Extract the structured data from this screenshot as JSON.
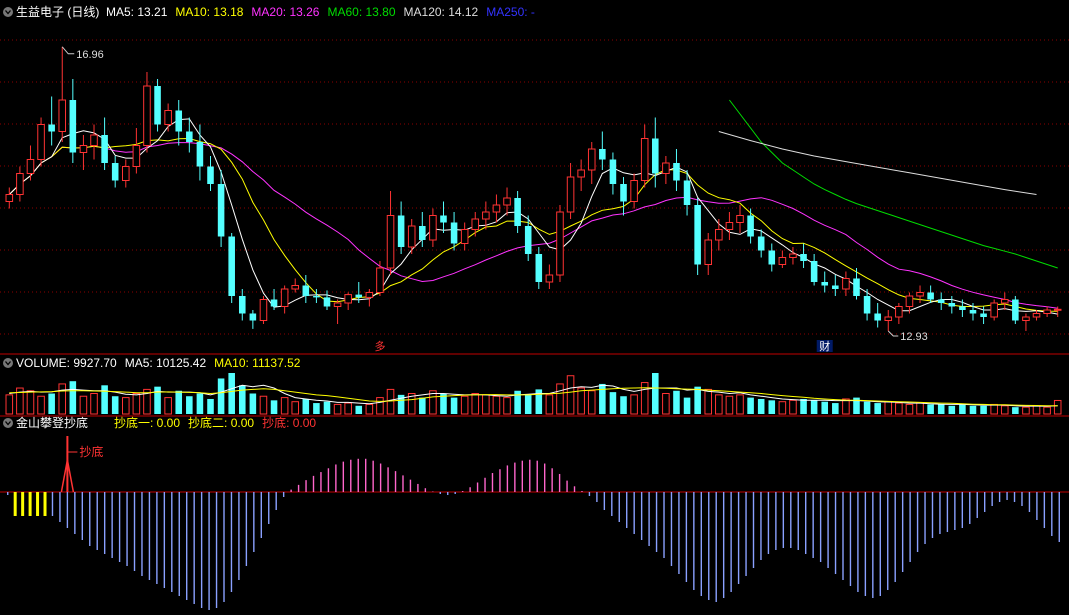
{
  "main_panel": {
    "title": "生益电子 (日线)",
    "ma_labels": [
      {
        "text": "MA5: 13.21",
        "color": "#ffffff"
      },
      {
        "text": "MA10: 13.18",
        "color": "#ffff00"
      },
      {
        "text": "MA20: 13.26",
        "color": "#ff33ff"
      },
      {
        "text": "MA60: 13.80",
        "color": "#00dd00"
      },
      {
        "text": "MA120: 14.12",
        "color": "#dddddd"
      },
      {
        "text": "MA250: -",
        "color": "#3333ff"
      }
    ],
    "high_label": "16.96",
    "low_label": "12.93",
    "event_mark_1": "多",
    "event_mark_2": "财"
  },
  "volume_panel": {
    "labels": [
      {
        "text": "VOLUME: 9927.70",
        "color": "#ffffff"
      },
      {
        "text": "MA5: 10125.42",
        "color": "#ffffff"
      },
      {
        "text": "MA10: 11137.52",
        "color": "#ffff00"
      }
    ]
  },
  "indicator_panel": {
    "title": "金山攀登抄底",
    "labels": [
      {
        "text": "抄底一: 0.00",
        "color": "#ffff00"
      },
      {
        "text": "抄底二: 0.00",
        "color": "#ffff00"
      },
      {
        "text": "抄底: 0.00",
        "color": "#ff3333"
      }
    ],
    "signal_label": "抄底"
  },
  "colors": {
    "up": "#ff3333",
    "down": "#54ffff",
    "grid": "#8b0000",
    "divider": "#c00000",
    "ma5": "#ffffff",
    "ma10": "#ffff00",
    "ma20": "#ff33ff",
    "ma60": "#00dd00",
    "ma120": "#dddddd",
    "osc_pos": "#ff66cc",
    "osc_neg": "#8aa0ff",
    "osc_signal": "#ffff00"
  },
  "chart_data": {
    "type": "candlestick",
    "y_range": [
      12.6,
      17.4
    ],
    "ohlc": [
      [
        14.75,
        14.95,
        14.65,
        14.85
      ],
      [
        14.85,
        15.25,
        14.75,
        15.15
      ],
      [
        15.15,
        15.55,
        15.05,
        15.35
      ],
      [
        15.35,
        15.95,
        15.25,
        15.85
      ],
      [
        15.85,
        16.25,
        15.55,
        15.75
      ],
      [
        15.75,
        16.96,
        15.6,
        16.2
      ],
      [
        16.2,
        16.5,
        15.3,
        15.45
      ],
      [
        15.45,
        15.7,
        15.2,
        15.55
      ],
      [
        15.55,
        15.85,
        15.35,
        15.7
      ],
      [
        15.7,
        15.95,
        15.2,
        15.3
      ],
      [
        15.3,
        15.4,
        14.95,
        15.05
      ],
      [
        15.05,
        15.35,
        14.95,
        15.25
      ],
      [
        15.25,
        15.8,
        15.15,
        15.55
      ],
      [
        15.55,
        16.6,
        15.45,
        16.4
      ],
      [
        16.4,
        16.5,
        15.75,
        15.85
      ],
      [
        15.85,
        16.15,
        15.75,
        16.05
      ],
      [
        16.05,
        16.2,
        15.55,
        15.75
      ],
      [
        15.75,
        15.95,
        15.45,
        15.6
      ],
      [
        15.6,
        15.85,
        15.05,
        15.25
      ],
      [
        15.25,
        15.4,
        14.9,
        15.0
      ],
      [
        15.0,
        15.2,
        14.1,
        14.25
      ],
      [
        14.25,
        14.3,
        13.3,
        13.4
      ],
      [
        13.4,
        13.5,
        13.05,
        13.15
      ],
      [
        13.15,
        13.2,
        12.93,
        13.05
      ],
      [
        13.05,
        13.4,
        13.0,
        13.35
      ],
      [
        13.35,
        13.5,
        13.2,
        13.25
      ],
      [
        13.25,
        13.55,
        13.15,
        13.5
      ],
      [
        13.5,
        13.65,
        13.45,
        13.55
      ],
      [
        13.55,
        13.7,
        13.3,
        13.4
      ],
      [
        13.4,
        13.5,
        13.3,
        13.38
      ],
      [
        13.38,
        13.48,
        13.2,
        13.25
      ],
      [
        13.25,
        13.35,
        13.0,
        13.3
      ],
      [
        13.3,
        13.45,
        13.2,
        13.42
      ],
      [
        13.42,
        13.6,
        13.3,
        13.38
      ],
      [
        13.38,
        13.5,
        13.25,
        13.45
      ],
      [
        13.45,
        13.9,
        13.4,
        13.8
      ],
      [
        13.8,
        14.9,
        13.7,
        14.55
      ],
      [
        14.55,
        14.75,
        14.0,
        14.1
      ],
      [
        14.1,
        14.5,
        14.0,
        14.4
      ],
      [
        14.4,
        14.6,
        14.1,
        14.2
      ],
      [
        14.2,
        14.65,
        14.1,
        14.55
      ],
      [
        14.55,
        14.75,
        14.3,
        14.45
      ],
      [
        14.45,
        14.6,
        14.05,
        14.15
      ],
      [
        14.15,
        14.45,
        14.05,
        14.35
      ],
      [
        14.35,
        14.6,
        14.25,
        14.5
      ],
      [
        14.5,
        14.75,
        14.35,
        14.6
      ],
      [
        14.6,
        14.85,
        14.45,
        14.7
      ],
      [
        14.7,
        14.95,
        14.55,
        14.8
      ],
      [
        14.8,
        14.9,
        14.3,
        14.4
      ],
      [
        14.4,
        14.55,
        13.9,
        14.0
      ],
      [
        14.0,
        14.1,
        13.5,
        13.6
      ],
      [
        13.6,
        13.85,
        13.5,
        13.7
      ],
      [
        13.7,
        14.7,
        13.6,
        14.6
      ],
      [
        14.6,
        15.3,
        14.5,
        15.1
      ],
      [
        15.1,
        15.35,
        14.9,
        15.2
      ],
      [
        15.2,
        15.6,
        15.0,
        15.5
      ],
      [
        15.5,
        15.75,
        15.2,
        15.35
      ],
      [
        15.35,
        15.45,
        14.85,
        15.0
      ],
      [
        15.0,
        15.1,
        14.55,
        14.75
      ],
      [
        14.75,
        15.15,
        14.65,
        15.05
      ],
      [
        15.05,
        15.85,
        14.95,
        15.65
      ],
      [
        15.65,
        15.95,
        14.95,
        15.15
      ],
      [
        15.15,
        15.4,
        15.0,
        15.3
      ],
      [
        15.3,
        15.5,
        14.9,
        15.05
      ],
      [
        15.05,
        15.2,
        14.55,
        14.7
      ],
      [
        14.7,
        14.8,
        13.7,
        13.85
      ],
      [
        13.85,
        14.3,
        13.7,
        14.2
      ],
      [
        14.2,
        14.5,
        14.05,
        14.35
      ],
      [
        14.35,
        14.6,
        14.2,
        14.45
      ],
      [
        14.45,
        14.7,
        14.3,
        14.55
      ],
      [
        14.55,
        14.65,
        14.15,
        14.25
      ],
      [
        14.25,
        14.35,
        13.95,
        14.05
      ],
      [
        14.05,
        14.15,
        13.75,
        13.85
      ],
      [
        13.85,
        14.05,
        13.8,
        13.95
      ],
      [
        13.95,
        14.1,
        13.85,
        14.0
      ],
      [
        14.0,
        14.15,
        13.8,
        13.9
      ],
      [
        13.9,
        14.0,
        13.55,
        13.6
      ],
      [
        13.6,
        13.75,
        13.45,
        13.55
      ],
      [
        13.55,
        13.7,
        13.4,
        13.5
      ],
      [
        13.5,
        13.75,
        13.4,
        13.65
      ],
      [
        13.65,
        13.8,
        13.35,
        13.4
      ],
      [
        13.4,
        13.5,
        13.05,
        13.15
      ],
      [
        13.15,
        13.3,
        12.95,
        13.05
      ],
      [
        13.05,
        13.2,
        12.9,
        13.1
      ],
      [
        13.1,
        13.3,
        13.0,
        13.25
      ],
      [
        13.25,
        13.45,
        13.15,
        13.4
      ],
      [
        13.4,
        13.55,
        13.3,
        13.45
      ],
      [
        13.45,
        13.55,
        13.3,
        13.35
      ],
      [
        13.35,
        13.45,
        13.2,
        13.3
      ],
      [
        13.3,
        13.4,
        13.15,
        13.25
      ],
      [
        13.25,
        13.35,
        13.1,
        13.2
      ],
      [
        13.2,
        13.3,
        13.05,
        13.15
      ],
      [
        13.15,
        13.25,
        13.0,
        13.1
      ],
      [
        13.1,
        13.35,
        13.05,
        13.3
      ],
      [
        13.3,
        13.45,
        13.2,
        13.35
      ],
      [
        13.35,
        13.4,
        13.0,
        13.05
      ],
      [
        13.05,
        13.15,
        12.9,
        13.1
      ],
      [
        13.1,
        13.2,
        13.05,
        13.15
      ],
      [
        13.15,
        13.25,
        13.1,
        13.2
      ],
      [
        13.2,
        13.25,
        13.1,
        13.21
      ]
    ],
    "ma60": [
      16.2,
      16.0,
      15.8,
      15.6,
      15.45,
      15.3,
      15.2,
      15.1,
      15.0,
      14.92,
      14.85,
      14.78,
      14.72,
      14.67,
      14.62,
      14.57,
      14.52,
      14.47,
      14.42,
      14.37,
      14.32,
      14.27,
      14.22,
      14.17,
      14.12,
      14.08,
      14.04,
      14.0,
      13.95,
      13.9,
      13.85,
      13.8
    ],
    "ma120": [
      15.75,
      15.62,
      15.5,
      15.4,
      15.32,
      15.24,
      15.16,
      15.08,
      15.0,
      14.92,
      14.85
    ],
    "volume": [
      14000,
      19000,
      17000,
      13000,
      15000,
      22000,
      24000,
      13000,
      15000,
      21000,
      13000,
      12000,
      15000,
      18000,
      20000,
      12000,
      17000,
      13000,
      15000,
      11000,
      26000,
      30000,
      21000,
      15000,
      13000,
      10000,
      12000,
      9000,
      11000,
      8000,
      9000,
      7000,
      8000,
      6000,
      7000,
      12000,
      18000,
      14000,
      15000,
      12000,
      17000,
      15000,
      12000,
      13000,
      15000,
      14000,
      13000,
      12000,
      17000,
      14000,
      18000,
      14000,
      22000,
      28000,
      19000,
      17000,
      22000,
      16000,
      13000,
      14000,
      23000,
      30000,
      15000,
      17000,
      12000,
      20000,
      18000,
      14000,
      13000,
      14000,
      12000,
      11000,
      10000,
      9000,
      10000,
      11000,
      10000,
      9000,
      8000,
      11000,
      12000,
      9000,
      8000,
      9000,
      8000,
      7000,
      8000,
      7000,
      7000,
      6000,
      7000,
      6000,
      6000,
      7000,
      6000,
      5000,
      5000,
      6000,
      5000,
      9900
    ],
    "volume_ma5": [
      15000,
      16000,
      16500,
      16000,
      16200,
      17500,
      18000,
      17500,
      17000,
      17000,
      16000,
      14500,
      14000,
      15000,
      16500,
      16000,
      16000,
      16000,
      15500,
      14000,
      16000,
      18500,
      21000,
      20000,
      21000,
      19000,
      15000,
      12000,
      11000,
      10000,
      9500,
      8500,
      8500,
      8000,
      7500,
      8500,
      10000,
      11500,
      13000,
      14000,
      15000,
      15000,
      14500,
      14000,
      14200,
      14000,
      13500,
      13000,
      14000,
      14500,
      15000,
      15000,
      17000,
      19000,
      20000,
      19500,
      21000,
      20500,
      18000,
      16500,
      18000,
      19000,
      19000,
      19000,
      17500,
      18000,
      16500,
      16000,
      15000,
      15500,
      14000,
      13000,
      12000,
      11000,
      10500,
      10000,
      10000,
      10000,
      9800,
      9800,
      9800,
      9500,
      9000,
      8800,
      8500,
      8000,
      8000,
      7500,
      7200,
      7000,
      7000,
      6800,
      6500,
      6500,
      6500,
      6000,
      5800,
      5800,
      5600,
      6000
    ],
    "volume_ma10": [
      15500,
      15700,
      16000,
      16200,
      16400,
      16800,
      17000,
      17000,
      16800,
      16600,
      16400,
      16000,
      15500,
      15500,
      16000,
      16200,
      16000,
      15800,
      15500,
      15000,
      15500,
      16500,
      17500,
      18000,
      18500,
      18000,
      17000,
      16000,
      15000,
      14000,
      13500,
      12500,
      11500,
      10500,
      9500,
      9200,
      9500,
      10000,
      10500,
      11500,
      12500,
      13000,
      13500,
      13800,
      14000,
      14200,
      14200,
      14000,
      14000,
      14000,
      14500,
      14800,
      15200,
      16000,
      17000,
      17500,
      18000,
      18500,
      18800,
      19000,
      19200,
      19000,
      18800,
      18500,
      18200,
      18000,
      17500,
      17000,
      16500,
      16000,
      15500,
      15000,
      14200,
      13500,
      12800,
      12200,
      11500,
      11000,
      10500,
      10200,
      10000,
      9800,
      9500,
      9200,
      9000,
      8800,
      8500,
      8200,
      8000,
      7800,
      7500,
      7200,
      7000,
      6800,
      6700,
      6500,
      6300,
      6200,
      6000,
      6000
    ],
    "oscillator": [
      -3,
      -6,
      -9,
      -12,
      -15,
      -19,
      -24,
      -30,
      -36,
      -42,
      -48,
      -54,
      -58,
      -62,
      -66,
      -70,
      -74,
      -79,
      -84,
      -88,
      -92,
      -96,
      -100,
      -104,
      -108,
      -112,
      -116,
      -118,
      -116,
      -110,
      -100,
      -88,
      -74,
      -60,
      -46,
      -32,
      -18,
      -5,
      5,
      15,
      25,
      34,
      42,
      50,
      58,
      64,
      68,
      70,
      70,
      66,
      60,
      52,
      44,
      35,
      26,
      17,
      8,
      1,
      -2,
      -3,
      -2,
      2,
      10,
      20,
      30,
      40,
      48,
      56,
      62,
      66,
      68,
      66,
      60,
      50,
      38,
      24,
      12,
      2,
      -4,
      -10,
      -18,
      -24,
      -30,
      -36,
      -42,
      -48,
      -54,
      -60,
      -66,
      -74,
      -82,
      -90,
      -98,
      -104,
      -108,
      -110,
      -106,
      -100,
      -92,
      -84,
      -76,
      -68,
      -62,
      -58,
      -56,
      -56,
      -58,
      -62,
      -66,
      -70,
      -76,
      -82,
      -88,
      -94,
      -100,
      -104,
      -106,
      -104,
      -98,
      -90,
      -80,
      -70,
      -60,
      -52,
      -46,
      -42,
      -40,
      -38,
      -36,
      -32,
      -26,
      -20,
      -14,
      -10,
      -8,
      -10,
      -14,
      -20,
      -28,
      -36,
      -44,
      -50
    ],
    "osc_signal_start": 1,
    "osc_signal_end": 5,
    "osc_buy_index": 8
  }
}
